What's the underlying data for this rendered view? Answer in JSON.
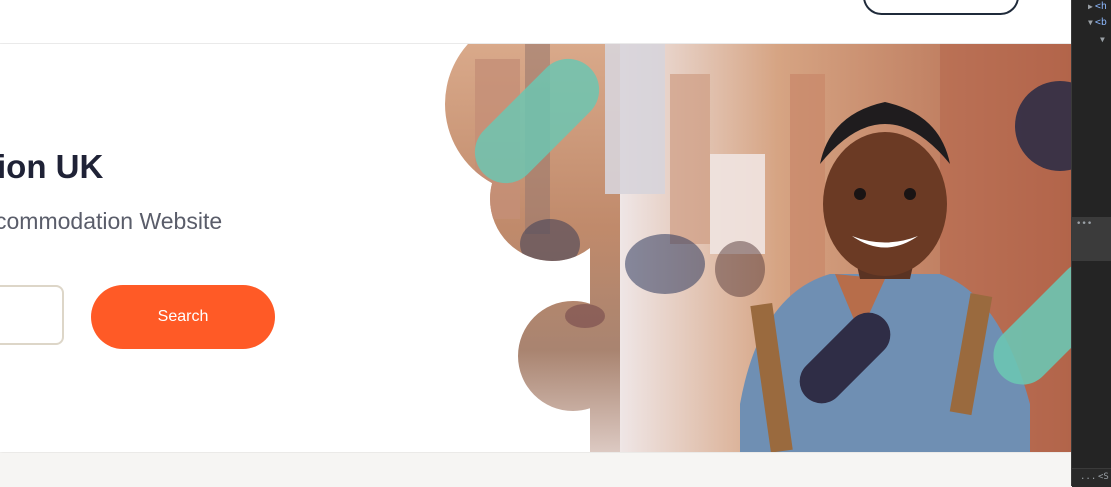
{
  "header": {
    "button_label": ""
  },
  "hero": {
    "title": "tion UK",
    "subtitle": "commodation Website",
    "search": {
      "value": "",
      "placeholder": "",
      "button_label": "Search"
    }
  },
  "colors": {
    "accent": "#ff5a26",
    "teal": "#6cc5b2",
    "navy": "#2f2d46",
    "title": "#1f2236",
    "subtitle": "#5a5d6a"
  },
  "devtools": {
    "nodes": [
      {
        "arrow": "▶",
        "text": "<h"
      },
      {
        "arrow": "▼",
        "text": "<b"
      },
      {
        "arrow": "▼",
        "text": ""
      }
    ],
    "ellipsis": "•••",
    "footer_dots": "...",
    "footer_text": "<S"
  }
}
